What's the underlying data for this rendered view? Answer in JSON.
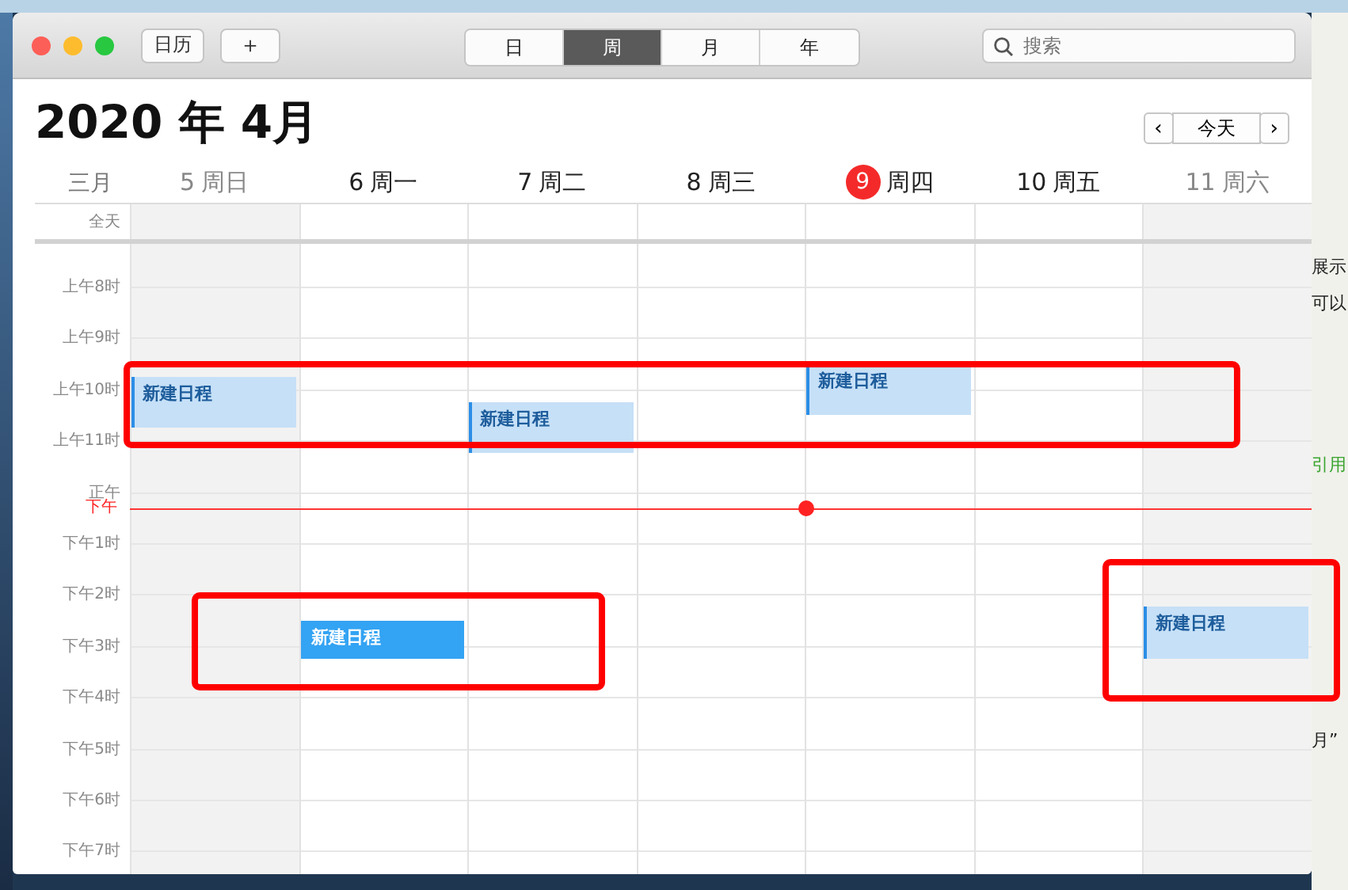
{
  "toolbar": {
    "calendars_button": "日历",
    "add_button": "＋",
    "views": [
      {
        "label": "日",
        "selected": false
      },
      {
        "label": "周",
        "selected": true
      },
      {
        "label": "月",
        "selected": false
      },
      {
        "label": "年",
        "selected": false
      }
    ],
    "search": {
      "placeholder": "搜索"
    }
  },
  "header": {
    "title": "2020 年 4月",
    "prev": "‹",
    "today": "今天",
    "next": "›",
    "month_label": "三月"
  },
  "days": [
    {
      "date": "5",
      "weekday": "周日",
      "weekend": true,
      "today": false,
      "events": [
        {
          "title": "新建日程",
          "selected": false
        }
      ]
    },
    {
      "date": "6",
      "weekday": "周一",
      "weekend": false,
      "today": false,
      "events": [
        {
          "title": "新建日程",
          "selected": true
        }
      ]
    },
    {
      "date": "7",
      "weekday": "周二",
      "weekend": false,
      "today": false,
      "events": [
        {
          "title": "新建日程",
          "selected": false
        }
      ]
    },
    {
      "date": "8",
      "weekday": "周三",
      "weekend": false,
      "today": false
    },
    {
      "date": "9",
      "weekday": "周四",
      "weekend": false,
      "today": true,
      "events": [
        {
          "title": "新建日程",
          "selected": false
        }
      ]
    },
    {
      "date": "10",
      "weekday": "周五",
      "weekend": false,
      "today": false
    },
    {
      "date": "11",
      "weekday": "周六",
      "weekend": true,
      "today": false,
      "events": [
        {
          "title": "新建日程",
          "selected": false
        }
      ]
    }
  ],
  "all_day_label": "全天",
  "hours": [
    "上午8时",
    "上午9时",
    "上午10时",
    "上午11时",
    "正午",
    "下午1时",
    "下午2时",
    "下午3时",
    "下午4时",
    "下午5时",
    "下午6时",
    "下午7时"
  ],
  "current_time": {
    "label": "下午"
  },
  "background_document": [
    {
      "text": "展示",
      "kind": "plain"
    },
    {
      "text": "可以",
      "kind": "plain"
    },
    {
      "text": "引用",
      "kind": "link"
    },
    {
      "text": "月”",
      "kind": "plain"
    }
  ],
  "annotations": [
    {
      "kind": "rectangle"
    },
    {
      "kind": "rectangle"
    },
    {
      "kind": "rectangle"
    }
  ]
}
